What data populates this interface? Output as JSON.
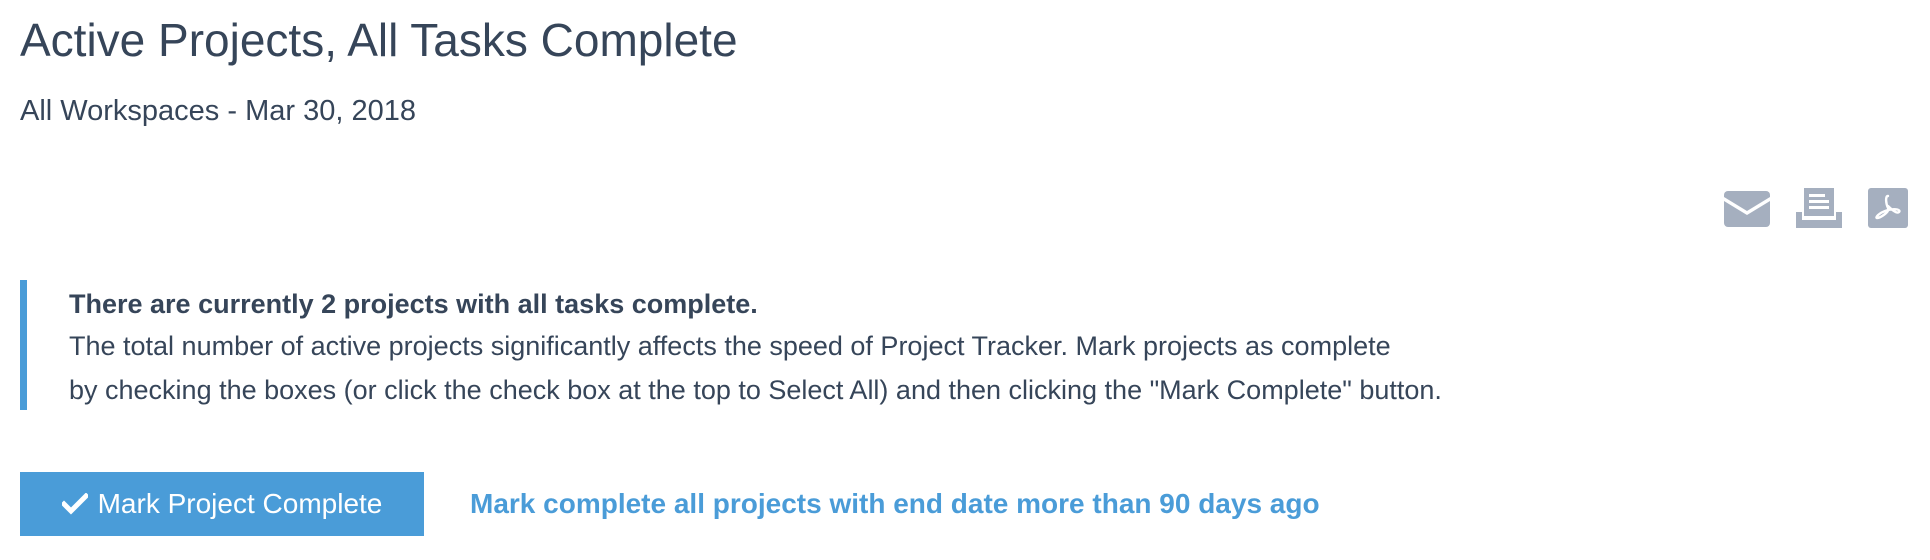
{
  "header": {
    "title": "Active Projects, All Tasks Complete",
    "subtitle": "All Workspaces - Mar 30, 2018"
  },
  "toolbar": {
    "icons": [
      "email-icon",
      "print-icon",
      "pdf-icon"
    ],
    "icon_color": "#a5afbf"
  },
  "notice": {
    "heading": "There are currently 2 projects with all tasks complete.",
    "line1": "The total number of active projects significantly affects the speed of Project Tracker. Mark projects as complete",
    "line2": "by checking the boxes (or click the check box at the top to Select All) and then clicking the \"Mark Complete\" button.",
    "accent_color": "#4a9cd8"
  },
  "actions": {
    "mark_button_label": "Mark Project Complete",
    "mark_button_icon": "check-icon",
    "mark_link_label": "Mark complete all projects with end date more than 90 days ago",
    "primary_color": "#4a9cd8"
  },
  "colors": {
    "text": "#364559",
    "background": "#ffffff"
  }
}
